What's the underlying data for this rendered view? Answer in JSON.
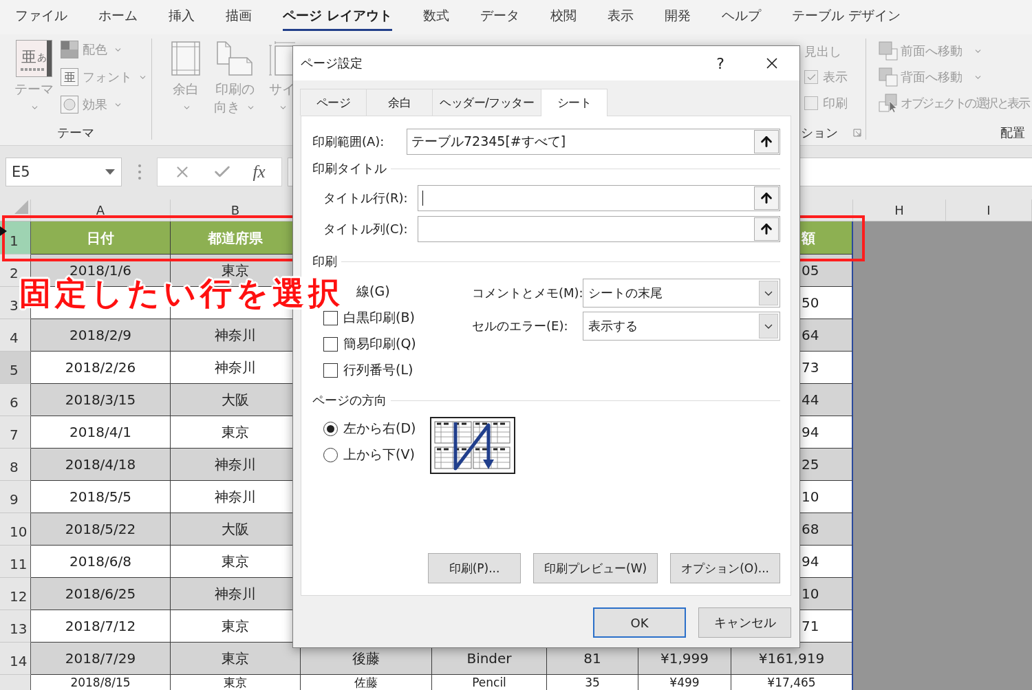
{
  "ribbon_tabs": [
    {
      "label": "ファイル",
      "selected": false
    },
    {
      "label": "ホーム",
      "selected": false
    },
    {
      "label": "挿入",
      "selected": false
    },
    {
      "label": "描画",
      "selected": false
    },
    {
      "label": "ページ レイアウト",
      "selected": true
    },
    {
      "label": "数式",
      "selected": false
    },
    {
      "label": "データ",
      "selected": false
    },
    {
      "label": "校閲",
      "selected": false
    },
    {
      "label": "表示",
      "selected": false
    },
    {
      "label": "開発",
      "selected": false
    },
    {
      "label": "ヘルプ",
      "selected": false
    },
    {
      "label": "テーブル デザイン",
      "selected": false
    }
  ],
  "ribbon": {
    "theme_group": {
      "label": "テーマ",
      "disabled": true,
      "theme_button": {
        "label": "テーマ",
        "glyph": "亜",
        "glyph_small": "あ",
        "dropdown": true
      },
      "commands": [
        {
          "kind": "colors",
          "label": "配色",
          "dropdown": true
        },
        {
          "kind": "fonts",
          "label": "フォント",
          "glyph": "亜",
          "dropdown": true
        },
        {
          "kind": "effects",
          "label": "効果",
          "dropdown": true
        }
      ]
    },
    "page_setup_group": {
      "disabled": true,
      "commands": [
        {
          "kind": "margins",
          "label": "余白",
          "dropdown": true
        },
        {
          "kind": "orientation",
          "label": "印刷の向き",
          "dropdown": true
        },
        {
          "kind": "size",
          "label": "サイ",
          "dropdown": true
        }
      ]
    },
    "sheet_options_group": {
      "label": "ション",
      "disabled": true,
      "heading_label": "見出し",
      "options": [
        {
          "label": "表示",
          "checked": true
        },
        {
          "label": "印刷",
          "checked": false
        }
      ]
    },
    "arrange_group": {
      "label": "配置",
      "disabled": true,
      "commands": [
        {
          "kind": "bring_forward",
          "label": "前面へ移動",
          "dropdown": true
        },
        {
          "kind": "send_backward",
          "label": "背面へ移動",
          "dropdown": true
        },
        {
          "kind": "selection_pane",
          "label": "オブジェクトの選択と表示",
          "dropdown": false
        }
      ]
    }
  },
  "formula_bar": {
    "name_box": "E5",
    "function_label": "fx"
  },
  "sheet": {
    "column_headers": {
      "left": [
        "A",
        "B"
      ],
      "right": [
        "H",
        "I"
      ]
    },
    "rows": [
      {
        "number": "1",
        "kind": "header",
        "selected": true,
        "active": false,
        "cells": [
          "日付",
          "都道府県"
        ],
        "cut_cell": "額"
      },
      {
        "number": "2",
        "kind": "shaded",
        "selected": false,
        "active": false,
        "cells": [
          "2018/1/6",
          "東京"
        ],
        "cut_cell": "05"
      },
      {
        "number": "3",
        "kind": "plain",
        "selected": false,
        "active": false,
        "cells": [],
        "cut_cell": "50"
      },
      {
        "number": "4",
        "kind": "shaded",
        "selected": false,
        "active": false,
        "cells": [
          "2018/2/9",
          "神奈川"
        ],
        "cut_cell": "64"
      },
      {
        "number": "5",
        "kind": "plain",
        "selected": false,
        "active": true,
        "cells": [
          "2018/2/26",
          "神奈川"
        ],
        "cut_cell": "73"
      },
      {
        "number": "6",
        "kind": "shaded",
        "selected": false,
        "active": false,
        "cells": [
          "2018/3/15",
          "大阪"
        ],
        "cut_cell": "44"
      },
      {
        "number": "7",
        "kind": "plain",
        "selected": false,
        "active": false,
        "cells": [
          "2018/4/1",
          "東京"
        ],
        "cut_cell": "94"
      },
      {
        "number": "8",
        "kind": "shaded",
        "selected": false,
        "active": false,
        "cells": [
          "2018/4/18",
          "神奈川"
        ],
        "cut_cell": "25"
      },
      {
        "number": "9",
        "kind": "plain",
        "selected": false,
        "active": false,
        "cells": [
          "2018/5/5",
          "神奈川"
        ],
        "cut_cell": "10"
      },
      {
        "number": "10",
        "kind": "shaded",
        "selected": false,
        "active": false,
        "cells": [
          "2018/5/22",
          "大阪"
        ],
        "cut_cell": "68"
      },
      {
        "number": "11",
        "kind": "plain",
        "selected": false,
        "active": false,
        "cells": [
          "2018/6/8",
          "東京"
        ],
        "cut_cell": "94"
      },
      {
        "number": "12",
        "kind": "shaded",
        "selected": false,
        "active": false,
        "cells": [
          "2018/6/25",
          "神奈川"
        ],
        "cut_cell": "10"
      },
      {
        "number": "13",
        "kind": "plain",
        "selected": false,
        "active": false,
        "cells": [
          "2018/7/12",
          "東京"
        ],
        "cut_cell": "71"
      },
      {
        "number": "14",
        "kind": "shaded",
        "selected": false,
        "active": false,
        "cells": [
          "2018/7/29",
          "東京",
          "後藤",
          "Binder",
          "81",
          "¥1,999",
          "¥161,919"
        ]
      },
      {
        "kind": "plain",
        "selected": false,
        "active": false,
        "cells": [
          "2018/8/15",
          "東京",
          "佐藤",
          "Pencil",
          "35",
          "¥499",
          "¥17,465"
        ]
      }
    ]
  },
  "annotation": {
    "callout": "固定したい行を選択"
  },
  "dialog": {
    "title": "ページ設定",
    "help": "?",
    "tabs": [
      {
        "label": "ページ",
        "selected": false
      },
      {
        "label": "余白",
        "selected": false
      },
      {
        "label": "ヘッダー/フッター",
        "selected": false
      },
      {
        "label": "シート",
        "selected": true
      }
    ],
    "print_area": {
      "label": "印刷範囲(A):",
      "value": "テーブル72345[#すべて]"
    },
    "print_titles": {
      "heading": "印刷タイトル",
      "fields": [
        {
          "label": "タイトル行(R):",
          "focused": true
        },
        {
          "label": "タイトル列(C):",
          "focused": false
        }
      ]
    },
    "print": {
      "heading": "印刷",
      "gridlines_label": "線(G)",
      "checkboxes": [
        {
          "label": "白黒印刷(B)",
          "checked": false
        },
        {
          "label": "簡易印刷(Q)",
          "checked": false
        },
        {
          "label": "行列番号(L)",
          "checked": false
        }
      ],
      "selects": [
        {
          "label": "コメントとメモ(M):",
          "value": "シートの末尾"
        },
        {
          "label": "セルのエラー(E):",
          "value": "表示する"
        }
      ]
    },
    "page_order": {
      "heading": "ページの方向",
      "options": [
        {
          "label": "左から右(D)",
          "selected": true
        },
        {
          "label": "上から下(V)",
          "selected": false
        }
      ]
    },
    "panel_buttons": [
      "印刷(P)...",
      "印刷プレビュー(W)",
      "オプション(O)..."
    ],
    "footer_buttons": [
      {
        "label": "OK",
        "default": true
      },
      {
        "label": "キャンセル",
        "default": false
      }
    ]
  }
}
